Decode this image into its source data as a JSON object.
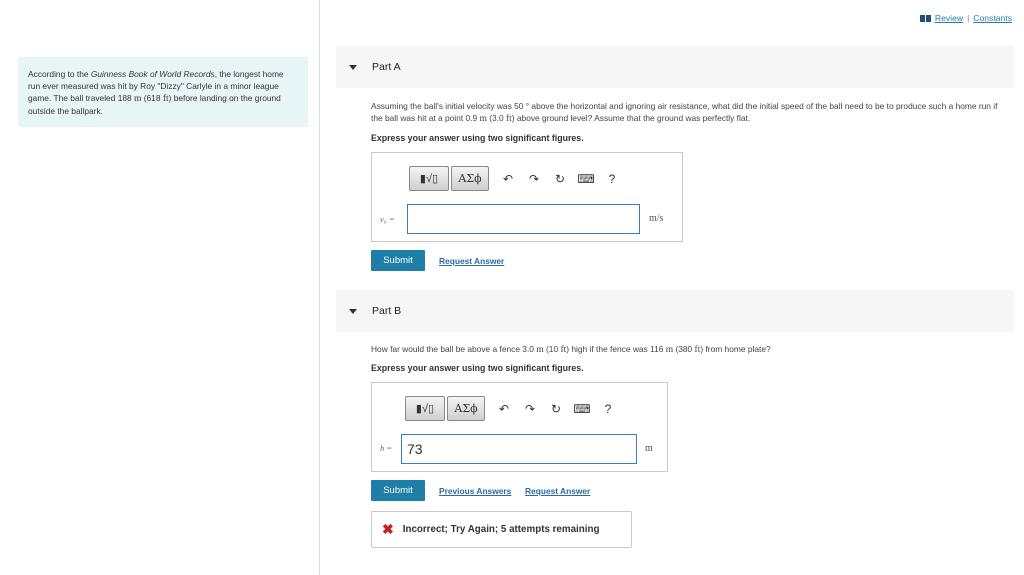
{
  "header": {
    "review_label": "Review",
    "separator": "|",
    "constants_label": "Constants"
  },
  "intro": {
    "p1": "According to the ",
    "source": "Guinness Book of World Records",
    "p2": ", the longest home run ever measured was hit by Roy \"Dizzy\" Carlyle in a minor league game. The ball traveled 188 ",
    "u1": "m",
    "p3": " (618 ",
    "u2": "ft",
    "p4": ") before landing on the ground outside the ballpark."
  },
  "partA": {
    "title": "Part A",
    "q1": "Assuming the ball's initial velocity was 50 ° above the horizontal and ignoring air resistance, what did the initial speed of the ball need to be to produce such a home run if the ball was hit at a point 0.9 ",
    "qu1": "m",
    "q2": " (3.0 ",
    "qu2": "ft",
    "q3": ") above ground level? Assume that the ground was perfectly flat.",
    "instruction": "Express your answer using two significant figures.",
    "answer_label": "v₀ =",
    "answer_value": "",
    "unit": "m/s",
    "submit_label": "Submit",
    "request_label": "Request Answer"
  },
  "partB": {
    "title": "Part B",
    "q1": "How far would the ball be above a fence 3.0 ",
    "qu1": "m",
    "q2": " (10 ",
    "qu2": "ft",
    "q3": ") high if the fence was 116 ",
    "qu3": "m",
    "q4": " (380 ",
    "qu4": "ft",
    "q5": ") from home plate?",
    "instruction": "Express your answer using two significant figures.",
    "answer_label": "h =",
    "answer_value": "73",
    "unit": "m",
    "submit_label": "Submit",
    "previous_label": "Previous Answers",
    "request_label": "Request Answer",
    "feedback": "Incorrect; Try Again; 5 attempts remaining"
  },
  "toolbar": {
    "templates_label": "▮√▯",
    "greek_label": "ΑΣϕ",
    "undo": "↶",
    "redo": "↷",
    "reset": "↻",
    "keyboard": "⌨",
    "help": "?"
  },
  "icons": {
    "book": "book-icon",
    "triangle": "triangle-down-icon",
    "incorrect": "x-mark-icon"
  },
  "colors": {
    "accent": "#1f7ea8",
    "link": "#2a6aa0",
    "intro_bg": "#e8f5f7",
    "error": "#c8201f"
  }
}
